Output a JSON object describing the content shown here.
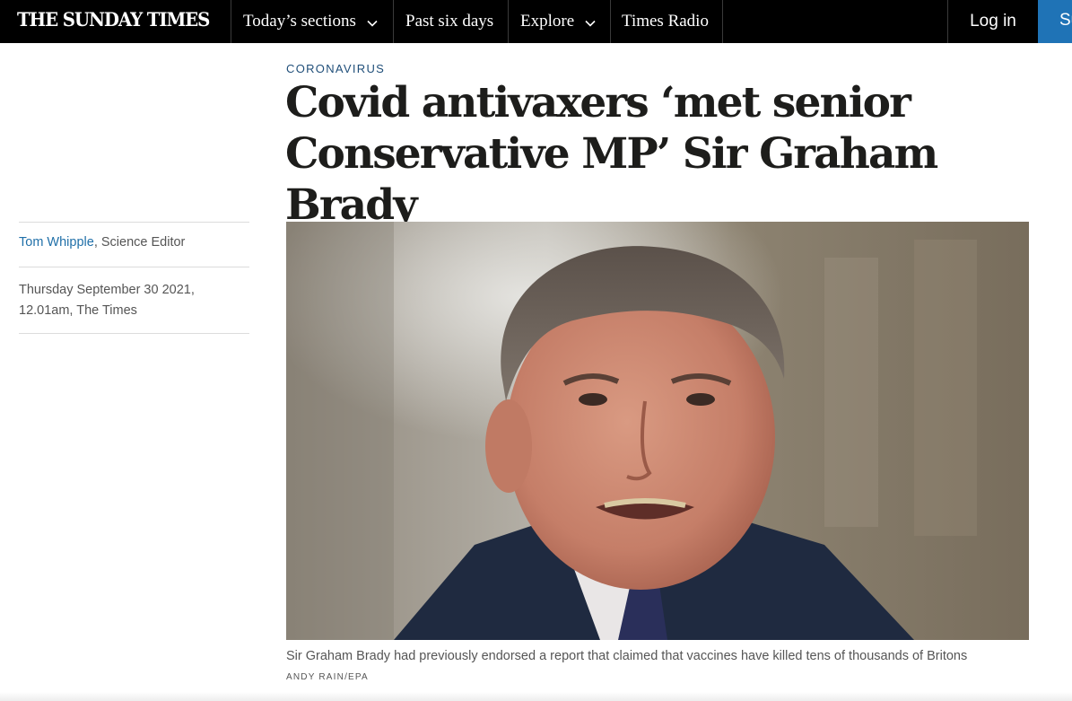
{
  "nav": {
    "logo": "THE SUNDAY TIMES",
    "items": [
      {
        "label": "Today’s sections",
        "has_dropdown": true
      },
      {
        "label": "Past six days",
        "has_dropdown": false
      },
      {
        "label": "Explore",
        "has_dropdown": true
      },
      {
        "label": "Times Radio",
        "has_dropdown": false
      }
    ],
    "login_label": "Log in",
    "subscribe_label": "Su"
  },
  "article": {
    "section": "CORONAVIRUS",
    "headline": "Covid antivaxers ‘met senior Conservative MP’ Sir Graham Brady",
    "author": "Tom Whipple",
    "author_role": ", Science Editor",
    "date_line1": "Thursday September 30 2021,",
    "date_line2": "12.01am, The Times",
    "image_caption": "Sir Graham Brady had previously endorsed a report that claimed that vaccines have killed tens of thousands of Britons",
    "image_credit": "ANDY RAIN/EPA"
  },
  "colors": {
    "nav_background": "#000000",
    "subscribe_accent": "#1f73b6",
    "author_link": "#1f6fa8",
    "section_tag": "#1f4e79"
  }
}
